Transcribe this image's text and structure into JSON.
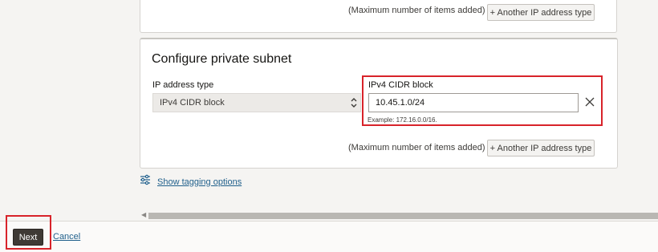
{
  "previous_section": {
    "max_note": "(Maximum number of items added)",
    "add_button": "+ Another IP address type"
  },
  "private_subnet": {
    "title": "Configure private subnet",
    "ip_type_label": "IP address type",
    "ip_type_value": "IPv4 CIDR block",
    "cidr_label": "IPv4 CIDR block",
    "cidr_value": "10.45.1.0/24",
    "cidr_example": "Example: 172.16.0.0/16.",
    "max_note": "(Maximum number of items added)",
    "add_button": "+ Another IP address type"
  },
  "tagging": {
    "link_label": "Show tagging options",
    "icon": "sliders-icon"
  },
  "footer": {
    "next_label": "Next",
    "cancel_label": "Cancel"
  },
  "colors": {
    "highlight": "#d8232a",
    "link": "#1f5f8b",
    "primary_button": "#3f3a35"
  }
}
